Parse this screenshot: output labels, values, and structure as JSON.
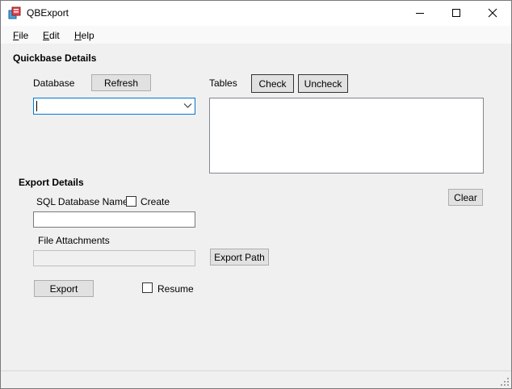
{
  "window": {
    "title": "QBExport",
    "controls": [
      "minimize-icon",
      "maximize-icon",
      "close-icon"
    ]
  },
  "menu": {
    "file": {
      "accel": "F",
      "rest": "ile"
    },
    "edit": {
      "accel": "E",
      "rest": "dit"
    },
    "help": {
      "accel": "H",
      "rest": "elp"
    }
  },
  "quickbase": {
    "heading": "Quickbase Details",
    "database_label": "Database",
    "refresh_label": "Refresh",
    "database_value": "",
    "tables_label": "Tables",
    "check_label": "Check",
    "uncheck_label": "Uncheck",
    "tables": []
  },
  "export": {
    "heading": "Export Details",
    "clear_label": "Clear",
    "sql_db_label": "SQL Database Name",
    "create_label": "Create",
    "create_checked": false,
    "sql_db_value": "",
    "attachments_label": "File Attachments",
    "attachments_value": "",
    "export_path_label": "Export Path",
    "export_label": "Export",
    "resume_label": "Resume",
    "resume_checked": false
  },
  "colors": {
    "focus_border": "#0078d7",
    "window_bg": "#f0f0f0",
    "button_bg": "#e1e1e1"
  }
}
